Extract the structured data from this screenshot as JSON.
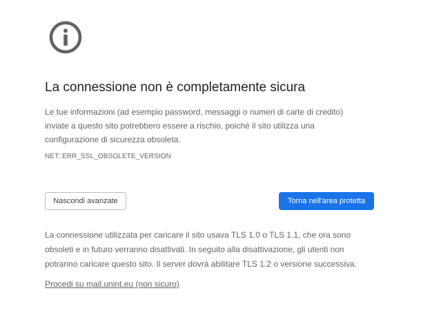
{
  "page": {
    "icon": "info-icon",
    "title": "La connessione non è completamente sicura",
    "message_lines": [
      "Le tue informazioni (ad esempio password, messaggi o numeri di carte di credito)",
      "inviate a questo sito potrebbero essere a rischio, poiché il sito utilizza una",
      "configurazione di sicurezza obsoleta."
    ],
    "error_code": "NET::ERR_SSL_OBSOLETE_VERSION"
  },
  "buttons": {
    "hide_advanced": "Nascondi avanzate",
    "back_to_safety": "Torna nell'area protetta"
  },
  "details": {
    "lines": [
      "La connessione utilizzata per caricare il sito usava TLS 1.0 o TLS 1.1, che ora sono",
      "obsoleti e in futuro verranno disattivati. In seguito alla disattivazione, gli utenti non",
      "potranno caricare questo sito. Il server dovrà abilitare TLS 1.2 o versione successiva."
    ],
    "proceed_link": "Procedi su mail.unint.eu (non sicuro)"
  },
  "colors": {
    "icon": "#5f6368",
    "primary_button": "#1a73e8",
    "text": "#202124",
    "secondary_text": "#5f6368"
  }
}
